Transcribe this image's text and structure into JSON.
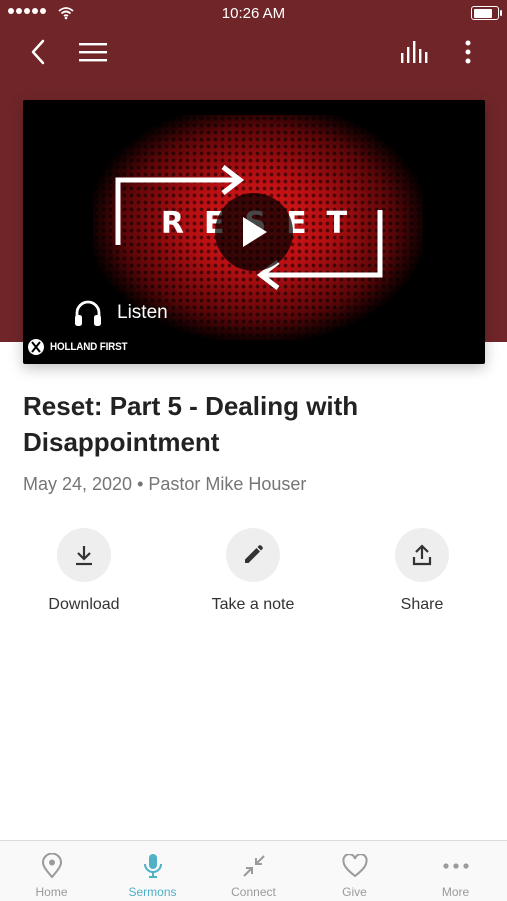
{
  "status_bar": {
    "time": "10:26 AM",
    "battery_level": 0.92
  },
  "colors": {
    "header_bg": "#702629",
    "accent": "#4fb0c6",
    "inactive": "#9a9a9a",
    "text_primary": "#222222",
    "text_secondary": "#757575"
  },
  "nav": {
    "icons": [
      "back-chevron-icon",
      "menu-icon",
      "audio-bars-icon",
      "more-vertical-icon"
    ]
  },
  "media": {
    "artwork_text": "RESET",
    "listen_label": "Listen",
    "brand_label": "HOLLAND FIRST"
  },
  "sermon": {
    "title": "Reset: Part 5 - Dealing with Disappointment",
    "meta": "May 24, 2020 • Pastor Mike Houser"
  },
  "actions": [
    {
      "label": "Download",
      "icon": "download-icon"
    },
    {
      "label": "Take a note",
      "icon": "pencil-icon"
    },
    {
      "label": "Share",
      "icon": "share-icon"
    }
  ],
  "tabs": [
    {
      "label": "Home",
      "icon": "location-pin-icon",
      "active": false
    },
    {
      "label": "Sermons",
      "icon": "microphone-icon",
      "active": true
    },
    {
      "label": "Connect",
      "icon": "collapse-arrows-icon",
      "active": false
    },
    {
      "label": "Give",
      "icon": "heart-icon",
      "active": false
    },
    {
      "label": "More",
      "icon": "more-horizontal-icon",
      "active": false
    }
  ]
}
